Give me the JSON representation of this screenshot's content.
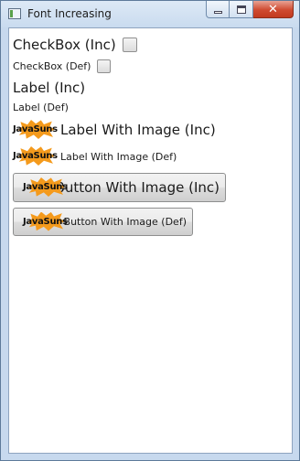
{
  "window": {
    "title": "Font Increasing",
    "close_glyph": "✕"
  },
  "content": {
    "checkbox_inc": "CheckBox (Inc)",
    "checkbox_def": "CheckBox (Def)",
    "label_inc": "Label (Inc)",
    "label_def": "Label (Def)",
    "label_image_inc": "Label With Image (Inc)",
    "label_image_def": "Label With Image (Def)",
    "button_image_inc": "Button With Image (Inc)",
    "button_image_def": "Button With Image (Def)",
    "logo_text": "JavaSuns"
  },
  "colors": {
    "accent": "#f49a1c",
    "close": "#cf4a30",
    "frame": "#c7d9ee"
  }
}
